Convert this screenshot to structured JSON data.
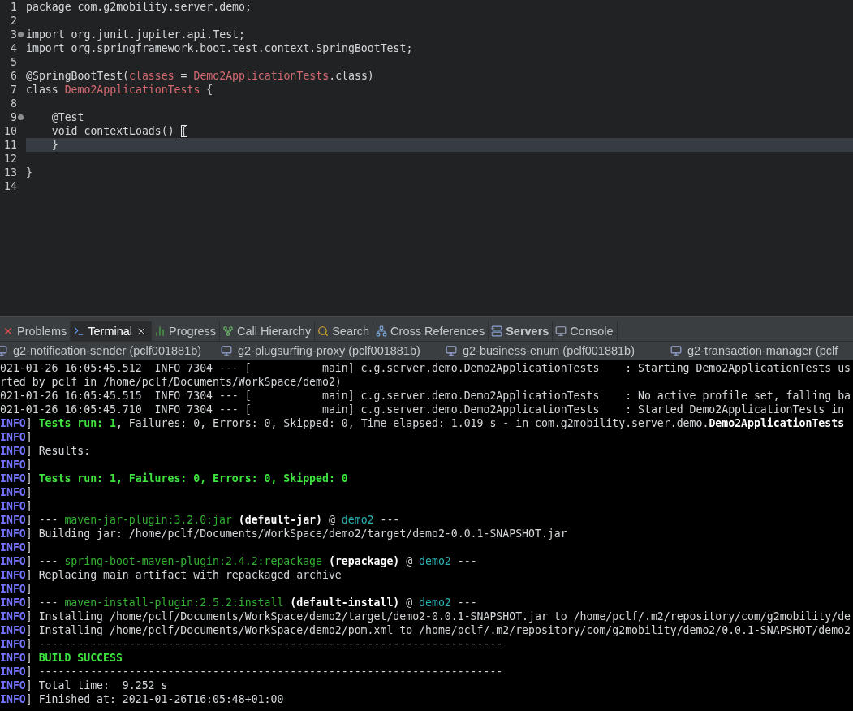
{
  "editor": {
    "lines": [
      {
        "number": "1",
        "fold": false,
        "current": false,
        "segs": [
          {
            "t": "package com.g2mobility.server.demo;",
            "kind": "plain"
          }
        ]
      },
      {
        "number": "2",
        "fold": false,
        "current": false
      },
      {
        "number": "3",
        "fold": true,
        "current": false,
        "segs": [
          {
            "t": "import org.junit.jupiter.api.Test;",
            "kind": "plain"
          }
        ]
      },
      {
        "number": "4",
        "fold": false,
        "current": false,
        "segs": [
          {
            "t": "import org.springframework.boot.test.context.SpringBootTest;",
            "kind": "plain"
          }
        ]
      },
      {
        "number": "5",
        "fold": false,
        "current": false
      },
      {
        "number": "6",
        "fold": false,
        "current": false,
        "segs": [
          {
            "t": "@SpringBootTest(",
            "kind": "plain"
          },
          {
            "t": "classes",
            "kind": "name"
          },
          {
            "t": " = ",
            "kind": "plain"
          },
          {
            "t": "Demo2ApplicationTests",
            "kind": "name"
          },
          {
            "t": ".class)",
            "kind": "plain"
          }
        ]
      },
      {
        "number": "7",
        "fold": false,
        "current": false,
        "segs": [
          {
            "t": "class ",
            "kind": "plain"
          },
          {
            "t": "Demo2ApplicationTests",
            "kind": "name"
          },
          {
            "t": " {",
            "kind": "plain"
          }
        ]
      },
      {
        "number": "8",
        "fold": false,
        "current": false
      },
      {
        "number": "9",
        "fold": true,
        "current": false,
        "segs": [
          {
            "t": "    @Test",
            "kind": "plain"
          }
        ]
      },
      {
        "number": "10",
        "fold": false,
        "current": false,
        "segs": [
          {
            "t": "    void contextLoads() ",
            "kind": "plain"
          },
          {
            "t": "{",
            "kind": "match"
          }
        ]
      },
      {
        "number": "11",
        "fold": false,
        "current": true,
        "segs": [
          {
            "t": "    }",
            "kind": "plain"
          }
        ]
      },
      {
        "number": "12",
        "fold": false,
        "current": false
      },
      {
        "number": "13",
        "fold": false,
        "current": false,
        "segs": [
          {
            "t": "}",
            "kind": "plain"
          }
        ]
      },
      {
        "number": "14",
        "fold": false,
        "current": false
      }
    ]
  },
  "view_tabs": [
    {
      "label": "Problems",
      "kind": "problems",
      "selected": false,
      "bold": false,
      "closable": false
    },
    {
      "label": "Terminal",
      "kind": "terminal",
      "selected": true,
      "bold": false,
      "closable": true
    },
    {
      "label": "Progress",
      "kind": "progress",
      "selected": false,
      "bold": false,
      "closable": false
    },
    {
      "label": "Call Hierarchy",
      "kind": "hierarchy",
      "selected": false,
      "bold": false,
      "closable": false
    },
    {
      "label": "Search",
      "kind": "search",
      "selected": false,
      "bold": false,
      "closable": false
    },
    {
      "label": "Cross References",
      "kind": "references",
      "selected": false,
      "bold": false,
      "closable": false
    },
    {
      "label": "Servers",
      "kind": "servers",
      "selected": false,
      "bold": true,
      "closable": false
    },
    {
      "label": "Console",
      "kind": "console",
      "selected": false,
      "bold": false,
      "closable": false
    }
  ],
  "terminal_tabs": [
    {
      "label": "g2-notification-sender (pclf001881b)",
      "selected": false
    },
    {
      "label": "g2-plugsurfing-proxy (pclf001881b)",
      "selected": false
    },
    {
      "label": "g2-business-enum (pclf001881b)",
      "selected": false
    },
    {
      "label": "g2-transaction-manager (pclf",
      "selected": false
    }
  ],
  "console": {
    "lines": [
      {
        "segs": [
          {
            "t": "021-01-26 16:05:45.512  INFO 7304 --- [           main] c.g.server.demo.Demo2ApplicationTests    : Starting Demo2ApplicationTests us",
            "kind": "plain"
          }
        ]
      },
      {
        "segs": [
          {
            "t": "rted by pclf in /home/pclf/Documents/WorkSpace/demo2)",
            "kind": "plain"
          }
        ]
      },
      {
        "segs": [
          {
            "t": "021-01-26 16:05:45.515  INFO 7304 --- [           main] c.g.server.demo.Demo2ApplicationTests    : No active profile set, falling ba",
            "kind": "plain"
          }
        ]
      },
      {
        "segs": [
          {
            "t": "021-01-26 16:05:45.710  INFO 7304 --- [           main] c.g.server.demo.Demo2ApplicationTests    : Started Demo2ApplicationTests in",
            "kind": "plain"
          }
        ]
      },
      {
        "segs": [
          {
            "t": "INFO",
            "kind": "level"
          },
          {
            "t": "] ",
            "kind": "plain"
          },
          {
            "t": "Tests run: 1",
            "kind": "pass"
          },
          {
            "t": ", Failures: 0, Errors: 0, Skipped: 0, Time elapsed: 1.019 s - in com.g2mobility.server.demo.",
            "kind": "plain"
          },
          {
            "t": "Demo2ApplicationTests",
            "kind": "bold"
          }
        ]
      },
      {
        "segs": [
          {
            "t": "INFO",
            "kind": "level"
          },
          {
            "t": "]",
            "kind": "plain"
          }
        ]
      },
      {
        "segs": [
          {
            "t": "INFO",
            "kind": "level"
          },
          {
            "t": "] Results:",
            "kind": "plain"
          }
        ]
      },
      {
        "segs": [
          {
            "t": "INFO",
            "kind": "level"
          },
          {
            "t": "]",
            "kind": "plain"
          }
        ]
      },
      {
        "segs": [
          {
            "t": "INFO",
            "kind": "level"
          },
          {
            "t": "] ",
            "kind": "plain"
          },
          {
            "t": "Tests run: 1, Failures: 0, Errors: 0, Skipped: 0",
            "kind": "pass"
          }
        ]
      },
      {
        "segs": [
          {
            "t": "INFO",
            "kind": "level"
          },
          {
            "t": "]",
            "kind": "plain"
          }
        ]
      },
      {
        "segs": [
          {
            "t": "INFO",
            "kind": "level"
          },
          {
            "t": "]",
            "kind": "plain"
          }
        ]
      },
      {
        "segs": [
          {
            "t": "INFO",
            "kind": "level"
          },
          {
            "t": "] --- ",
            "kind": "plain"
          },
          {
            "t": "maven-jar-plugin:3.2.0:jar",
            "kind": "plugin"
          },
          {
            "t": " (default-jar)",
            "kind": "bold"
          },
          {
            "t": " @ ",
            "kind": "plain"
          },
          {
            "t": "demo2",
            "kind": "project"
          },
          {
            "t": " ---",
            "kind": "plain"
          }
        ]
      },
      {
        "segs": [
          {
            "t": "INFO",
            "kind": "level"
          },
          {
            "t": "] Building jar: /home/pclf/Documents/WorkSpace/demo2/target/demo2-0.0.1-SNAPSHOT.jar",
            "kind": "plain"
          }
        ]
      },
      {
        "segs": [
          {
            "t": "INFO",
            "kind": "level"
          },
          {
            "t": "]",
            "kind": "plain"
          }
        ]
      },
      {
        "segs": [
          {
            "t": "INFO",
            "kind": "level"
          },
          {
            "t": "] --- ",
            "kind": "plain"
          },
          {
            "t": "spring-boot-maven-plugin:2.4.2:repackage",
            "kind": "plugin"
          },
          {
            "t": " (repackage)",
            "kind": "bold"
          },
          {
            "t": " @ ",
            "kind": "plain"
          },
          {
            "t": "demo2",
            "kind": "project"
          },
          {
            "t": " ---",
            "kind": "plain"
          }
        ]
      },
      {
        "segs": [
          {
            "t": "INFO",
            "kind": "level"
          },
          {
            "t": "] Replacing main artifact with repackaged archive",
            "kind": "plain"
          }
        ]
      },
      {
        "segs": [
          {
            "t": "INFO",
            "kind": "level"
          },
          {
            "t": "]",
            "kind": "plain"
          }
        ]
      },
      {
        "segs": [
          {
            "t": "INFO",
            "kind": "level"
          },
          {
            "t": "] --- ",
            "kind": "plain"
          },
          {
            "t": "maven-install-plugin:2.5.2:install",
            "kind": "plugin"
          },
          {
            "t": " (default-install)",
            "kind": "bold"
          },
          {
            "t": " @ ",
            "kind": "plain"
          },
          {
            "t": "demo2",
            "kind": "project"
          },
          {
            "t": " ---",
            "kind": "plain"
          }
        ]
      },
      {
        "segs": [
          {
            "t": "INFO",
            "kind": "level"
          },
          {
            "t": "] Installing /home/pclf/Documents/WorkSpace/demo2/target/demo2-0.0.1-SNAPSHOT.jar to /home/pclf/.m2/repository/com/g2mobility/de",
            "kind": "plain"
          }
        ]
      },
      {
        "segs": [
          {
            "t": "INFO",
            "kind": "level"
          },
          {
            "t": "] Installing /home/pclf/Documents/WorkSpace/demo2/pom.xml to /home/pclf/.m2/repository/com/g2mobility/demo2/0.0.1-SNAPSHOT/demo2",
            "kind": "plain"
          }
        ]
      },
      {
        "segs": [
          {
            "t": "INFO",
            "kind": "level"
          },
          {
            "t": "] ------------------------------------------------------------------------",
            "kind": "plain"
          }
        ]
      },
      {
        "segs": [
          {
            "t": "INFO",
            "kind": "level"
          },
          {
            "t": "] ",
            "kind": "plain"
          },
          {
            "t": "BUILD SUCCESS",
            "kind": "pass"
          }
        ]
      },
      {
        "segs": [
          {
            "t": "INFO",
            "kind": "level"
          },
          {
            "t": "] ------------------------------------------------------------------------",
            "kind": "plain"
          }
        ]
      },
      {
        "segs": [
          {
            "t": "INFO",
            "kind": "level"
          },
          {
            "t": "] Total time:  9.252 s",
            "kind": "plain"
          }
        ]
      },
      {
        "segs": [
          {
            "t": "INFO",
            "kind": "level"
          },
          {
            "t": "] Finished at: 2021-01-26T16:05:48+01:00",
            "kind": "plain"
          }
        ]
      }
    ]
  }
}
